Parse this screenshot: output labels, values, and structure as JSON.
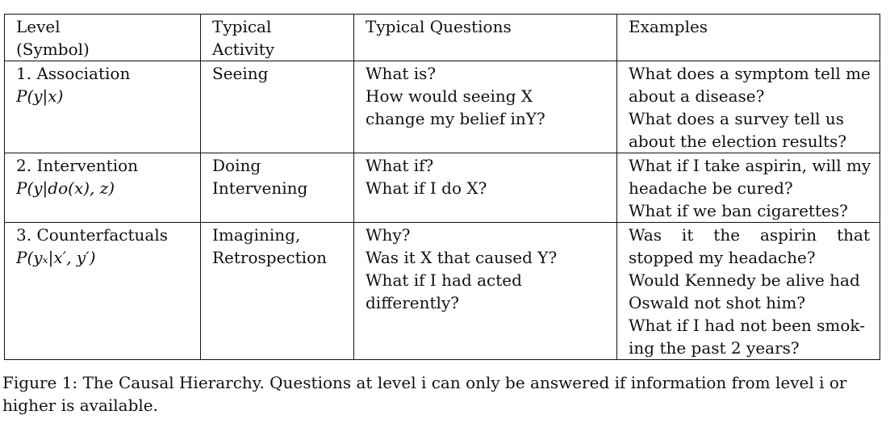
{
  "table": {
    "headers": [
      [
        "Level",
        "(Symbol)"
      ],
      [
        "Typical",
        "Activity"
      ],
      [
        "Typical Questions"
      ],
      [
        "Examples"
      ]
    ],
    "rows": [
      {
        "level": [
          "1. Association",
          "P(y|x)"
        ],
        "activity": [
          "Seeing"
        ],
        "questions": [
          "What is?",
          "How would seeing X",
          "change my belief inY?"
        ],
        "examples": [
          "What does a symptom tell me",
          "about a disease?",
          "What does a survey tell us",
          "about the election results?"
        ]
      },
      {
        "level": [
          "2. Intervention",
          "P(y|do(x), z)"
        ],
        "activity": [
          "Doing",
          "Intervening"
        ],
        "questions": [
          "What if?",
          "What if I do X?"
        ],
        "examples": [
          "What if I take aspirin, will my",
          "headache be cured?",
          "What if we ban cigarettes?"
        ]
      },
      {
        "level": [
          "3. Counterfactuals",
          "P(yₓ|x′, y′)"
        ],
        "activity": [
          "Imagining,",
          "Retrospection"
        ],
        "questions": [
          "Why?",
          "Was it X that caused Y?",
          "What if I had acted",
          "differently?"
        ],
        "examples": [
          "Was it the aspirin that",
          "stopped my headache?",
          "Would Kennedy be alive had",
          "Oswald not shot him?",
          "What if I had not been smok-",
          "ing the past 2 years?"
        ]
      }
    ]
  },
  "caption": {
    "line1": "Figure 1: The Causal Hierarchy. Questions at level i can only be answered if information from level i or",
    "line2": "higher is available."
  }
}
